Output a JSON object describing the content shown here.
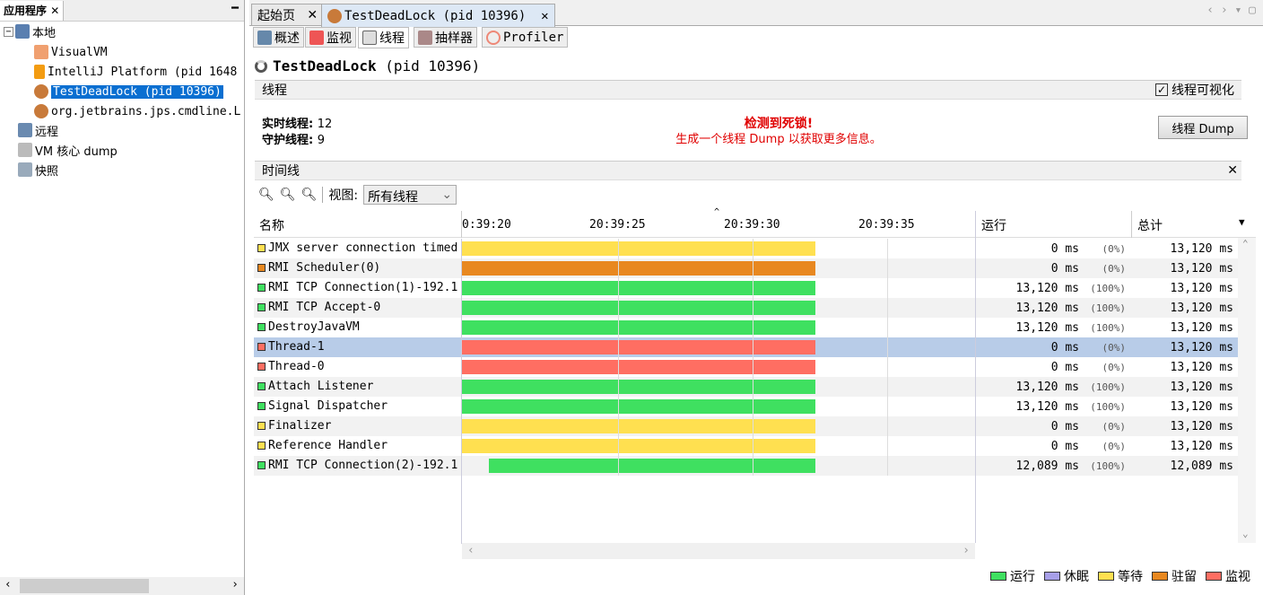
{
  "left_panel": {
    "tab_label": "应用程序",
    "tree": {
      "local": "本地",
      "children": [
        "VisualVM",
        "IntelliJ Platform (pid 1648",
        "TestDeadLock (pid 10396)",
        "org.jetbrains.jps.cmdline.L"
      ],
      "remote": "远程",
      "vm_core": "VM 核心 dump",
      "snapshot": "快照"
    }
  },
  "doc_tabs": [
    "起始页",
    "TestDeadLock (pid 10396)"
  ],
  "sub_tabs": [
    "概述",
    "监视",
    "线程",
    "抽样器",
    "Profiler"
  ],
  "app_title": "TestDeadLock",
  "app_pid": "(pid 10396)",
  "threads_section": {
    "title": "线程",
    "visualize_label": "线程可视化",
    "visualize_checked": true,
    "live_label": "实时线程:",
    "live_value": "12",
    "daemon_label": "守护线程:",
    "daemon_value": "9",
    "deadlock_title": "检测到死锁!",
    "deadlock_msg": "生成一个线程 Dump 以获取更多信息。",
    "dump_button": "线程 Dump"
  },
  "timeline": {
    "title": "时间线",
    "view_label": "视图:",
    "view_value": "所有线程",
    "columns": {
      "name": "名称",
      "run": "运行",
      "total": "总计"
    },
    "ticks": [
      "0:39:20",
      "20:39:25",
      "20:39:30",
      "20:39:35"
    ],
    "rows": [
      {
        "name": "JMX server connection timed",
        "state": "wait",
        "start": 0,
        "run": "0 ms",
        "pct": "(0%)",
        "total": "13,120 ms"
      },
      {
        "name": "RMI Scheduler(0)",
        "state": "park",
        "start": 0,
        "run": "0 ms",
        "pct": "(0%)",
        "total": "13,120 ms"
      },
      {
        "name": "RMI TCP Connection(1)-192.1",
        "state": "run",
        "start": 0,
        "run": "13,120 ms",
        "pct": "(100%)",
        "total": "13,120 ms"
      },
      {
        "name": "RMI TCP Accept-0",
        "state": "run",
        "start": 0,
        "run": "13,120 ms",
        "pct": "(100%)",
        "total": "13,120 ms"
      },
      {
        "name": "DestroyJavaVM",
        "state": "run",
        "start": 0,
        "run": "13,120 ms",
        "pct": "(100%)",
        "total": "13,120 ms"
      },
      {
        "name": "Thread-1",
        "state": "monitor",
        "start": 0,
        "run": "0 ms",
        "pct": "(0%)",
        "total": "13,120 ms",
        "selected": true
      },
      {
        "name": "Thread-0",
        "state": "monitor",
        "start": 0,
        "run": "0 ms",
        "pct": "(0%)",
        "total": "13,120 ms"
      },
      {
        "name": "Attach Listener",
        "state": "run",
        "start": 0,
        "run": "13,120 ms",
        "pct": "(100%)",
        "total": "13,120 ms"
      },
      {
        "name": "Signal Dispatcher",
        "state": "run",
        "start": 0,
        "run": "13,120 ms",
        "pct": "(100%)",
        "total": "13,120 ms"
      },
      {
        "name": "Finalizer",
        "state": "wait",
        "start": 0,
        "run": "0 ms",
        "pct": "(0%)",
        "total": "13,120 ms"
      },
      {
        "name": "Reference Handler",
        "state": "wait",
        "start": 0,
        "run": "0 ms",
        "pct": "(0%)",
        "total": "13,120 ms"
      },
      {
        "name": "RMI TCP Connection(2)-192.1",
        "state": "run",
        "start": 1,
        "run": "12,089 ms",
        "pct": "(100%)",
        "total": "12,089 ms"
      }
    ],
    "legend": [
      {
        "key": "run",
        "label": "运行"
      },
      {
        "key": "sleep",
        "label": "休眠"
      },
      {
        "key": "wait",
        "label": "等待"
      },
      {
        "key": "park",
        "label": "驻留"
      },
      {
        "key": "monitor",
        "label": "监视"
      }
    ]
  },
  "colors": {
    "run": "#3fe060",
    "sleep": "#a79fe8",
    "wait": "#ffe050",
    "park": "#e88820",
    "monitor": "#ff6e62",
    "selection": "#b8cce8",
    "deadlock": "#e00000"
  }
}
